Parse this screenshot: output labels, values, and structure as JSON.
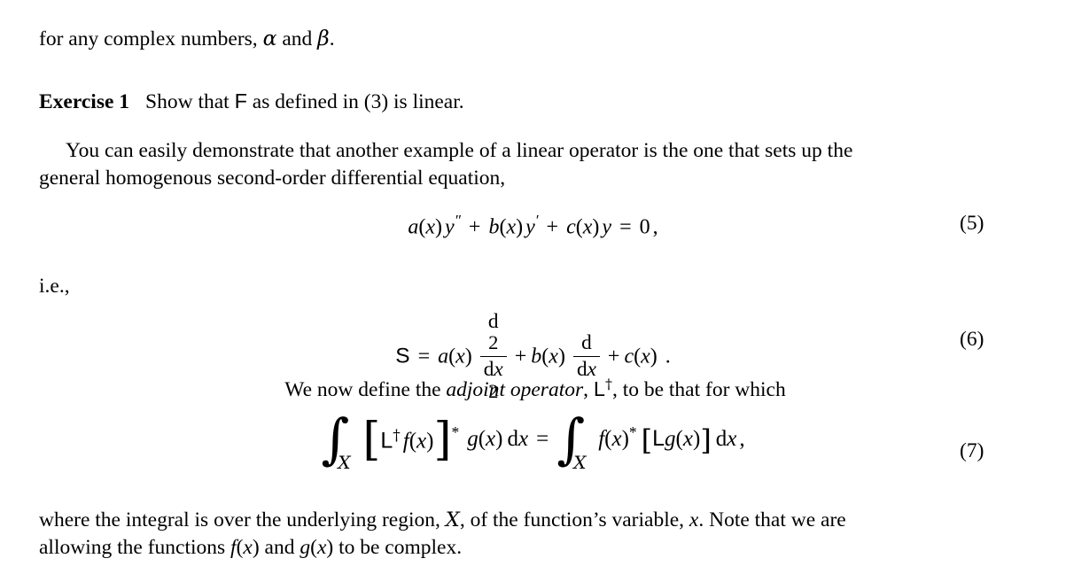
{
  "document": {
    "type": "mathematics-textbook-page",
    "body_font": "serif",
    "text_color": "#000000",
    "background_color": "#ffffff"
  },
  "line_complex_numbers": {
    "prefix": "for any complex numbers, ",
    "alpha": "α",
    "joiner": " and ",
    "beta": "β",
    "suffix": "."
  },
  "exercise": {
    "label": "Exercise 1",
    "text_before_operator": "Show that ",
    "operator": "F",
    "text_after_operator": " as defined in (3) is linear."
  },
  "paragraph_linear_operator": {
    "line1": "You can easily demonstrate that another example of a linear operator is the one that sets up the",
    "line2": "general homogenous second-order differential equation,"
  },
  "equation5": {
    "number": "(5)",
    "a": "a",
    "x": "x",
    "y": "y",
    "b": "b",
    "c": "c",
    "prime2": "″",
    "prime1": "′",
    "plus": "+",
    "equals": "=",
    "zero": "0",
    "comma": ",",
    "open_paren": "(",
    "close_paren": ")",
    "latex": "a(x) y'' + b(x) y' + c(x) y = 0 ,"
  },
  "line_ie": {
    "text": "i.e.,"
  },
  "equation6": {
    "number": "(6)",
    "operator": "S",
    "equals": "=",
    "a": "a",
    "b": "b",
    "c": "c",
    "x": "x",
    "plus": "+",
    "period": ".",
    "frac1_num_d": "d",
    "frac1_num_exp": "2",
    "frac1_den_d": "d",
    "frac1_den_x": "x",
    "frac1_den_exp": "2",
    "frac2_num_d": "d",
    "frac2_den_d": "d",
    "frac2_den_x": "x",
    "open_paren": "(",
    "close_paren": ")",
    "latex": "S = a(x) d^2/dx^2 + b(x) d/dx + c(x) ."
  },
  "line_adjoint": {
    "text_before": "We now define the ",
    "emphasis": "adjoint operator",
    "comma": ", ",
    "operator": "L",
    "dagger": "†",
    "text_after": ", to be that for which"
  },
  "equation7": {
    "number": "(7)",
    "integral": "∫",
    "limit": "X",
    "bracket_open": "[",
    "bracket_close": "]",
    "operator_L": "L",
    "dagger": "†",
    "f": "f",
    "g": "g",
    "x": "x",
    "star": "*",
    "d": "d",
    "equals": "=",
    "comma": ",",
    "open_paren": "(",
    "close_paren": ")",
    "latex": "\\int_X [L^\\dagger f(x)]^* g(x) dx = \\int_X f(x)^* [L g(x)] dx ,"
  },
  "paragraph_where": {
    "line1_part1": "where the integral is over the underlying region, ",
    "line1_calX": "X",
    "line1_part2": ", of the function’s variable, ",
    "line1_var": "x",
    "line1_part3": ". Note that we are",
    "line2_part1": "allowing the functions ",
    "line2_f": "f",
    "line2_open1": "(",
    "line2_x1": "x",
    "line2_close1": ")",
    "line2_and": " and ",
    "line2_g": "g",
    "line2_open2": "(",
    "line2_x2": "x",
    "line2_close2": ")",
    "line2_part2": " to be complex."
  }
}
